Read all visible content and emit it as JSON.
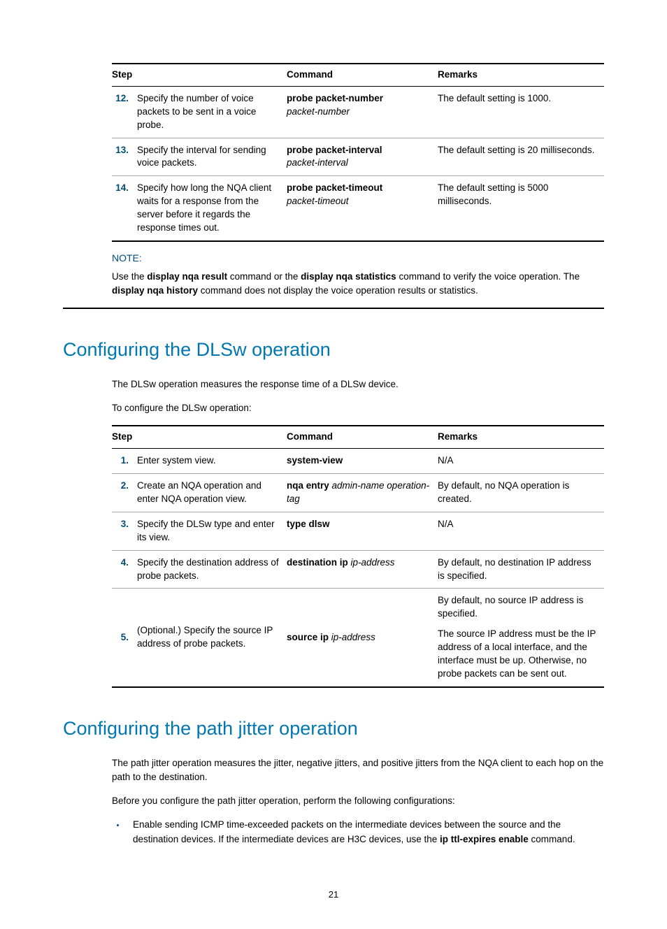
{
  "table1": {
    "headers": {
      "step": "Step",
      "command": "Command",
      "remarks": "Remarks"
    },
    "rows": [
      {
        "num": "12.",
        "desc": "Specify the number of voice packets to be sent in a voice probe.",
        "cmd_bold": "probe packet-number",
        "cmd_ital": "packet-number",
        "remarks": "The default setting is 1000."
      },
      {
        "num": "13.",
        "desc": "Specify the interval for sending voice packets.",
        "cmd_bold": "probe packet-interval",
        "cmd_ital": "packet-interval",
        "remarks": "The default setting is 20 milliseconds."
      },
      {
        "num": "14.",
        "desc": "Specify how long the NQA client waits for a response from the server before it regards the response times out.",
        "cmd_bold": "probe packet-timeout",
        "cmd_ital": "packet-timeout",
        "remarks": "The default setting is 5000 milliseconds."
      }
    ]
  },
  "note": {
    "label": "NOTE:",
    "p1a": "Use the ",
    "p1b": "display nqa result",
    "p1c": " command or the ",
    "p1d": "display nqa statistics",
    "p1e": " command to verify the voice operation. The ",
    "p1f": "display nqa history",
    "p1g": " command does not display the voice operation results or statistics."
  },
  "section1": {
    "heading": "Configuring the DLSw operation",
    "p1": "The DLSw operation measures the response time of a DLSw device.",
    "p2": "To configure the DLSw operation:"
  },
  "table2": {
    "headers": {
      "step": "Step",
      "command": "Command",
      "remarks": "Remarks"
    },
    "rows": [
      {
        "num": "1.",
        "desc": "Enter system view.",
        "cmd_bold": "system-view",
        "cmd_ital": "",
        "remarks": "N/A"
      },
      {
        "num": "2.",
        "desc": "Create an NQA operation and enter NQA operation view.",
        "cmd_bold": "nqa entry",
        "cmd_ital": " admin-name operation-tag",
        "remarks": "By default, no NQA operation is created."
      },
      {
        "num": "3.",
        "desc": "Specify the DLSw type and enter its view.",
        "cmd_bold": "type dlsw",
        "cmd_ital": "",
        "remarks": "N/A"
      },
      {
        "num": "4.",
        "desc": "Specify the destination address of probe packets.",
        "cmd_bold": "destination ip",
        "cmd_ital": " ip-address",
        "remarks": "By default, no destination IP address is specified."
      },
      {
        "num": "5.",
        "desc": "(Optional.) Specify the source IP address of probe packets.",
        "cmd_bold": "source ip",
        "cmd_ital": " ip-address",
        "remarks_p1": "By default, no source IP address is specified.",
        "remarks_p2": "The source IP address must be the IP address of a local interface, and the interface must be up. Otherwise, no probe packets can be sent out."
      }
    ]
  },
  "section2": {
    "heading": "Configuring the path jitter operation",
    "p1": "The path jitter operation measures the jitter, negative jitters, and positive jitters from the NQA client to each hop on the path to the destination.",
    "p2": "Before you configure the path jitter operation, perform the following configurations:",
    "bullet1_a": "Enable sending ICMP time-exceeded packets on the intermediate devices between the source and the destination devices. If the intermediate devices are H3C devices, use the ",
    "bullet1_b": "ip ttl-expires enable",
    "bullet1_c": " command."
  },
  "page_num": "21"
}
